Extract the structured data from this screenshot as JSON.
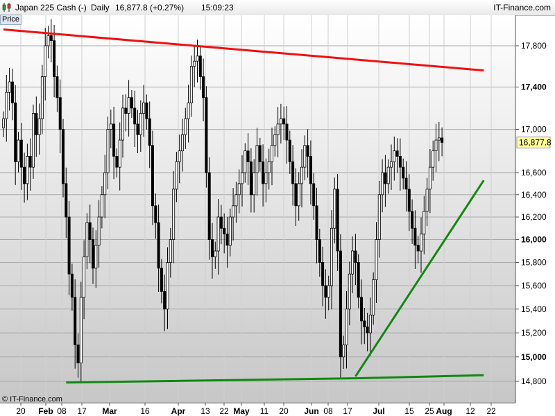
{
  "header": {
    "instrument": "Japan 225 Cash (-)",
    "period": "Daily",
    "quote": "16,877.8 (+0.27%)",
    "time": "15:09:23",
    "site": "IT-Finance.com"
  },
  "price_label": "Price",
  "copyright": "© IT-Finance.com",
  "colors": {
    "resistance": "#ee1111",
    "support": "#118811",
    "candle": "#000000",
    "current_tag": "#ffff99"
  },
  "chart_data": {
    "type": "candlestick",
    "title": "Japan 225 Cash (-)",
    "ylabel": "Price",
    "y_scale": "log",
    "ylim": [
      14650,
      18200
    ],
    "y_ticks": [
      {
        "value": 14800,
        "label": "14,800",
        "bold": false
      },
      {
        "value": 15000,
        "label": "15,000",
        "bold": true
      },
      {
        "value": 15200,
        "label": "15,200",
        "bold": false
      },
      {
        "value": 15400,
        "label": "15,400",
        "bold": false
      },
      {
        "value": 15600,
        "label": "15,600",
        "bold": false
      },
      {
        "value": 15800,
        "label": "15,800",
        "bold": false
      },
      {
        "value": 16000,
        "label": "16,000",
        "bold": true
      },
      {
        "value": 16200,
        "label": "16,200",
        "bold": false
      },
      {
        "value": 16400,
        "label": "16,400",
        "bold": false
      },
      {
        "value": 16600,
        "label": "16,600",
        "bold": false
      },
      {
        "value": 17000,
        "label": "17,000",
        "bold": false
      },
      {
        "value": 17400,
        "label": "17,400",
        "bold": true
      },
      {
        "value": 17800,
        "label": "17,800",
        "bold": false
      }
    ],
    "x_ticks": [
      {
        "label": "20",
        "bold": false
      },
      {
        "label": "Feb",
        "bold": true
      },
      {
        "label": "08",
        "bold": false
      },
      {
        "label": "17",
        "bold": false
      },
      {
        "label": "Mar",
        "bold": true
      },
      {
        "label": "16",
        "bold": false
      },
      {
        "label": "Apr",
        "bold": true
      },
      {
        "label": "13",
        "bold": false
      },
      {
        "label": "22",
        "bold": false
      },
      {
        "label": "May",
        "bold": true
      },
      {
        "label": "11",
        "bold": false
      },
      {
        "label": "20",
        "bold": false
      },
      {
        "label": "Jun",
        "bold": true
      },
      {
        "label": "08",
        "bold": false
      },
      {
        "label": "17",
        "bold": false
      },
      {
        "label": "Jul",
        "bold": true
      },
      {
        "label": "15",
        "bold": false
      },
      {
        "label": "25",
        "bold": false
      },
      {
        "label": "Aug",
        "bold": true
      },
      {
        "label": "12",
        "bold": false
      },
      {
        "label": "22",
        "bold": false
      }
    ],
    "last_price": 16877.8,
    "last_price_label": "16,877.8",
    "trendlines": [
      {
        "name": "resistance",
        "points": [
          [
            0,
            17960
          ],
          [
            161,
            17560
          ]
        ]
      },
      {
        "name": "support",
        "points": [
          [
            21,
            14790
          ],
          [
            118,
            14825
          ],
          [
            161,
            14850
          ]
        ]
      },
      {
        "name": "rising support",
        "points": [
          [
            118,
            14840
          ],
          [
            161,
            16530
          ]
        ]
      }
    ],
    "closes": [
      17100,
      17350,
      17450,
      17250,
      16700,
      16900,
      16650,
      16500,
      16750,
      16650,
      17150,
      16950,
      17100,
      17500,
      17800,
      17900,
      17850,
      17500,
      17300,
      17000,
      16500,
      16200,
      15700,
      15500,
      15100,
      14950,
      15500,
      15850,
      16150,
      16000,
      15750,
      15950,
      16200,
      16400,
      16600,
      17000,
      17050,
      16750,
      16650,
      16900,
      17200,
      17150,
      17300,
      17200,
      17050,
      16950,
      17150,
      17250,
      17100,
      16850,
      16300,
      16150,
      15750,
      15550,
      15400,
      15800,
      16000,
      16450,
      16700,
      16800,
      16950,
      17100,
      17250,
      17600,
      17650,
      17700,
      17500,
      17300,
      16600,
      16000,
      15850,
      15900,
      16200,
      16100,
      16050,
      15950,
      16200,
      16300,
      16400,
      16500,
      16600,
      16800,
      16700,
      16400,
      16600,
      16850,
      16700,
      16500,
      16600,
      16700,
      16850,
      16950,
      17050,
      17100,
      17050,
      16900,
      16700,
      16500,
      16300,
      16500,
      16650,
      16850,
      16750,
      16500,
      16300,
      16000,
      15800,
      15600,
      15500,
      15600,
      16100,
      16450,
      15900,
      15000,
      15100,
      15400,
      15700,
      15900,
      15800,
      15500,
      15300,
      15250,
      15200,
      15350,
      15650,
      16000,
      16400,
      16600,
      16500,
      16650,
      16700,
      16800,
      16750,
      16650,
      16550,
      16450,
      16250,
      16100,
      15950,
      15900,
      16050,
      16250,
      16450,
      16650,
      16800,
      16900,
      16920,
      16877.8
    ]
  }
}
